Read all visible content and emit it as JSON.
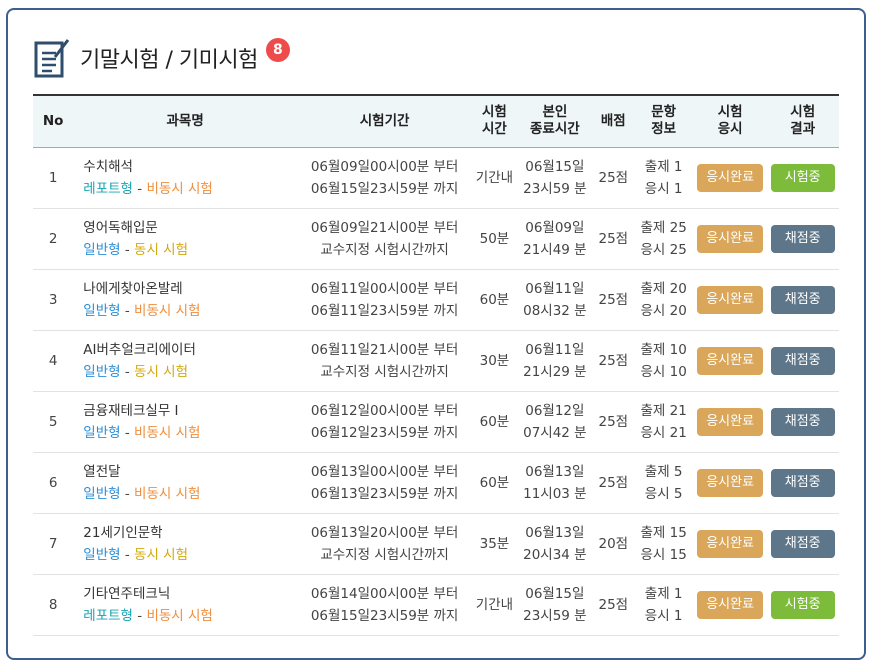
{
  "page": {
    "title": "기말시험 / 기미시험",
    "badge_count": "8"
  },
  "colors": {
    "card_border": "#3d5f8f",
    "badge": "#ee4b4b",
    "header_bg": "#eef6f8",
    "btn_done": "#d9a65a",
    "btn_in_progress": "#7dbb3a",
    "btn_grading": "#5e7689",
    "type_teal": "#15a3b3",
    "type_blue": "#2c8fd6",
    "mode_orange": "#ef8e3c",
    "mode_yellow": "#d4a90c"
  },
  "icons": {
    "header": "document-list-icon"
  },
  "table": {
    "headers": {
      "no": "No",
      "subject": "과목명",
      "period": "시험기간",
      "time_1": "시험",
      "time_2": "시간",
      "end_1": "본인",
      "end_2": "종료시간",
      "score": "배점",
      "questions_1": "문항",
      "questions_2": "정보",
      "take_1": "시험",
      "take_2": "응시",
      "result_1": "시험",
      "result_2": "결과"
    },
    "rows": [
      {
        "no": "1",
        "subject": "수치해석",
        "type": "레포트형",
        "type_color": "teal",
        "sep": " - ",
        "mode": "비동시 시험",
        "mode_color": "orange",
        "period_start": "06월09일00시00분 부터",
        "period_end": "06월15일23시59분 까지",
        "duration": "기간내",
        "end_date": "06월15일",
        "end_time": "23시59 분",
        "score": "25점",
        "q_total": "출제 1",
        "q_taken": "응시 1",
        "take_label": "응시완료",
        "result_label": "시험중",
        "result_state": "green"
      },
      {
        "no": "2",
        "subject": "영어독해입문",
        "type": "일반형",
        "type_color": "blue",
        "sep": " - ",
        "mode": "동시 시험",
        "mode_color": "yellow",
        "period_start": "06월09일21시00분 부터",
        "period_end": "교수지정 시험시간까지",
        "duration": "50분",
        "end_date": "06월09일",
        "end_time": "21시49 분",
        "score": "25점",
        "q_total": "출제 25",
        "q_taken": "응시 25",
        "take_label": "응시완료",
        "result_label": "채점중",
        "result_state": "gray"
      },
      {
        "no": "3",
        "subject": "나에게찾아온발레",
        "type": "일반형",
        "type_color": "blue",
        "sep": " - ",
        "mode": "비동시 시험",
        "mode_color": "orange",
        "period_start": "06월11일00시00분 부터",
        "period_end": "06월11일23시59분 까지",
        "duration": "60분",
        "end_date": "06월11일",
        "end_time": "08시32 분",
        "score": "25점",
        "q_total": "출제 20",
        "q_taken": "응시 20",
        "take_label": "응시완료",
        "result_label": "채점중",
        "result_state": "gray"
      },
      {
        "no": "4",
        "subject": "AI버추얼크리에이터",
        "type": "일반형",
        "type_color": "blue",
        "sep": " - ",
        "mode": "동시 시험",
        "mode_color": "yellow",
        "period_start": "06월11일21시00분 부터",
        "period_end": "교수지정 시험시간까지",
        "duration": "30분",
        "end_date": "06월11일",
        "end_time": "21시29 분",
        "score": "25점",
        "q_total": "출제 10",
        "q_taken": "응시 10",
        "take_label": "응시완료",
        "result_label": "채점중",
        "result_state": "gray"
      },
      {
        "no": "5",
        "subject": "금융재테크실무 Ⅰ",
        "type": "일반형",
        "type_color": "blue",
        "sep": " - ",
        "mode": "비동시 시험",
        "mode_color": "orange",
        "period_start": "06월12일00시00분 부터",
        "period_end": "06월12일23시59분 까지",
        "duration": "60분",
        "end_date": "06월12일",
        "end_time": "07시42 분",
        "score": "25점",
        "q_total": "출제 21",
        "q_taken": "응시 21",
        "take_label": "응시완료",
        "result_label": "채점중",
        "result_state": "gray"
      },
      {
        "no": "6",
        "subject": "열전달",
        "type": "일반형",
        "type_color": "blue",
        "sep": " - ",
        "mode": "비동시 시험",
        "mode_color": "orange",
        "period_start": "06월13일00시00분 부터",
        "period_end": "06월13일23시59분 까지",
        "duration": "60분",
        "end_date": "06월13일",
        "end_time": "11시03 분",
        "score": "25점",
        "q_total": "출제 5",
        "q_taken": "응시 5",
        "take_label": "응시완료",
        "result_label": "채점중",
        "result_state": "gray"
      },
      {
        "no": "7",
        "subject": "21세기인문학",
        "type": "일반형",
        "type_color": "blue",
        "sep": " - ",
        "mode": "동시 시험",
        "mode_color": "yellow",
        "period_start": "06월13일20시00분 부터",
        "period_end": "교수지정 시험시간까지",
        "duration": "35분",
        "end_date": "06월13일",
        "end_time": "20시34 분",
        "score": "20점",
        "q_total": "출제 15",
        "q_taken": "응시 15",
        "take_label": "응시완료",
        "result_label": "채점중",
        "result_state": "gray"
      },
      {
        "no": "8",
        "subject": "기타연주테크닉",
        "type": "레포트형",
        "type_color": "teal",
        "sep": " - ",
        "mode": "비동시 시험",
        "mode_color": "orange",
        "period_start": "06월14일00시00분 부터",
        "period_end": "06월15일23시59분 까지",
        "duration": "기간내",
        "end_date": "06월15일",
        "end_time": "23시59 분",
        "score": "25점",
        "q_total": "출제 1",
        "q_taken": "응시 1",
        "take_label": "응시완료",
        "result_label": "시험중",
        "result_state": "green"
      }
    ]
  }
}
